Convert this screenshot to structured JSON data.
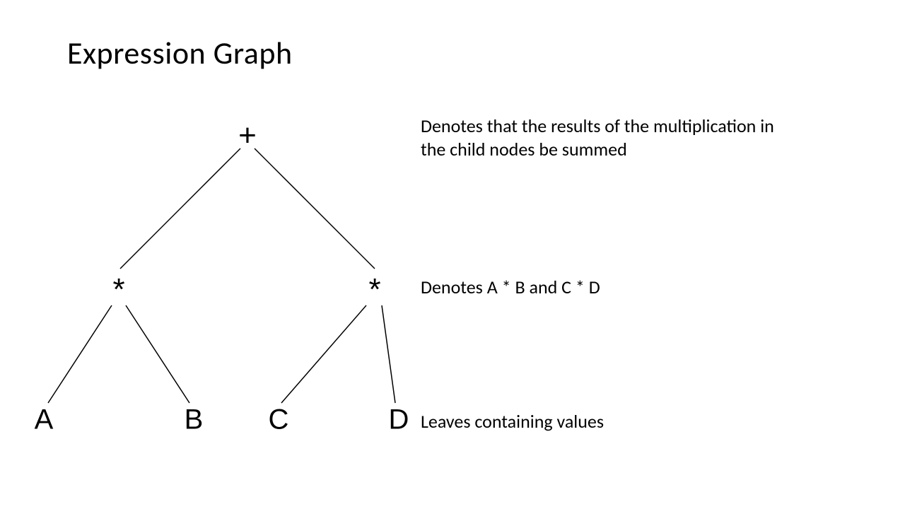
{
  "title": "Expression Graph",
  "tree": {
    "root": "+",
    "mul_left": "*",
    "mul_right": "*",
    "leaf_a": "A",
    "leaf_b": "B",
    "leaf_c": "C",
    "leaf_d": "D"
  },
  "annotations": {
    "root_note": "Denotes that the results of the multiplication in the child nodes be summed",
    "mul_note": "Denotes A * B and C * D",
    "leaf_note": "Leaves containing values"
  }
}
